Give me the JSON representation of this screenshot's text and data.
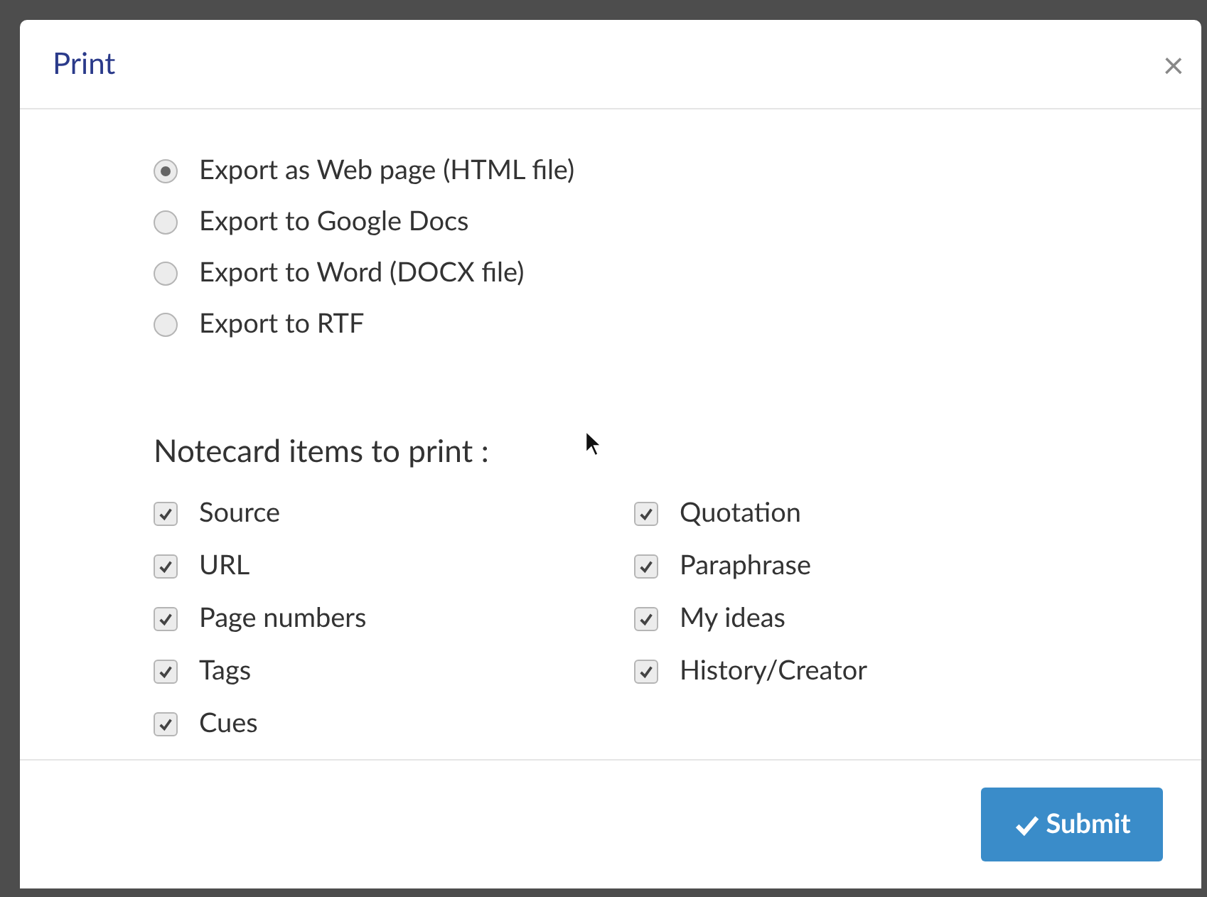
{
  "dialog": {
    "title": "Print",
    "close": "×"
  },
  "export_options": [
    {
      "label": "Export as Web page (HTML file)",
      "selected": true
    },
    {
      "label": "Export to Google Docs",
      "selected": false
    },
    {
      "label": "Export to Word (DOCX file)",
      "selected": false
    },
    {
      "label": "Export to RTF",
      "selected": false
    }
  ],
  "items_heading": "Notecard items to print :",
  "items": [
    {
      "label": "Source",
      "checked": true
    },
    {
      "label": "Quotation",
      "checked": true
    },
    {
      "label": "URL",
      "checked": true
    },
    {
      "label": "Paraphrase",
      "checked": true
    },
    {
      "label": "Page numbers",
      "checked": true
    },
    {
      "label": "My ideas",
      "checked": true
    },
    {
      "label": "Tags",
      "checked": true
    },
    {
      "label": "History/Creator",
      "checked": true
    },
    {
      "label": "Cues",
      "checked": true
    }
  ],
  "submit": "Submit"
}
